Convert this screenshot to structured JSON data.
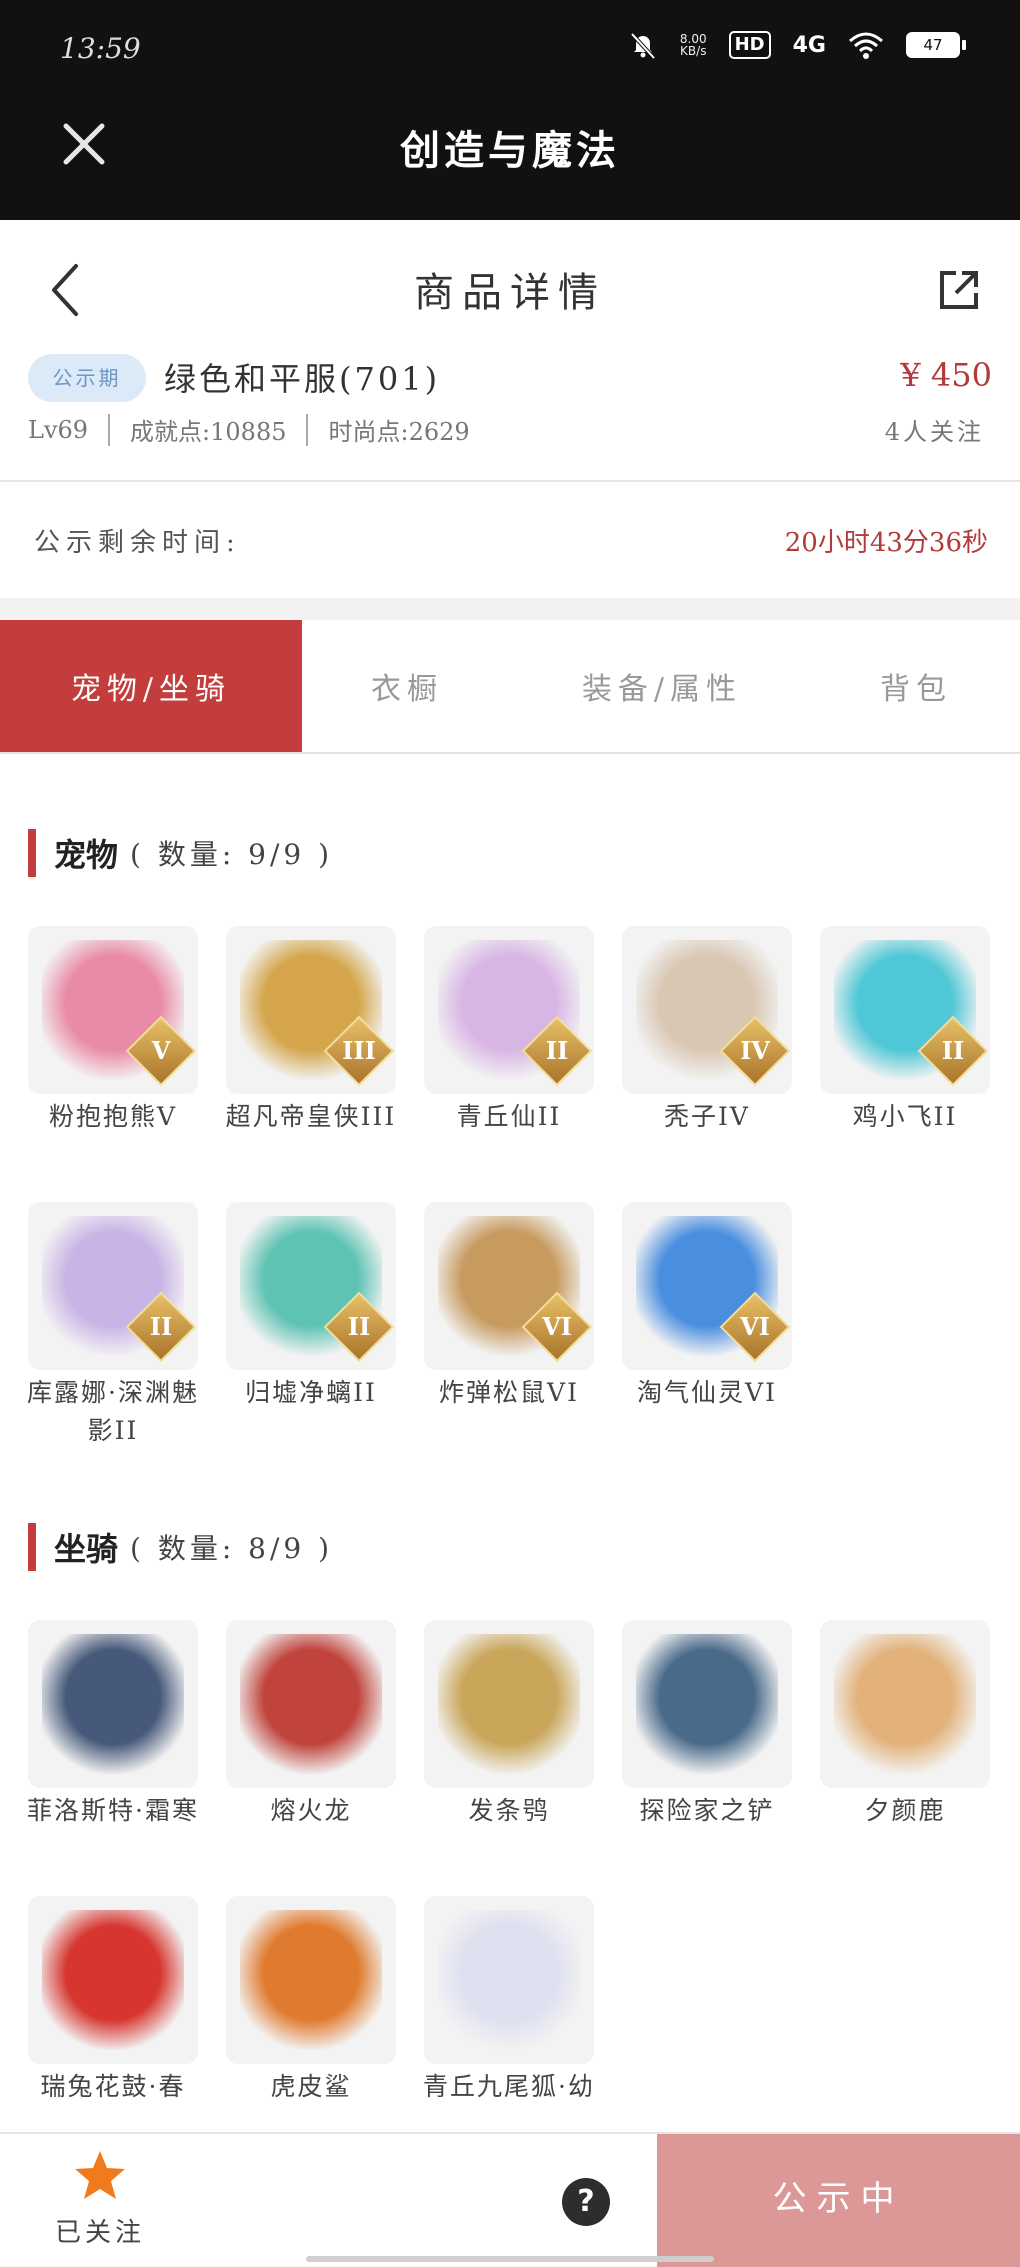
{
  "status_bar": {
    "time": "13:59",
    "speed_value": "8.00",
    "speed_unit": "KB/s",
    "hd": "HD",
    "network": "4G",
    "battery": "47"
  },
  "app": {
    "title": "创造与魔法"
  },
  "nav": {
    "title": "商品详情"
  },
  "item": {
    "badge": "公示期",
    "name": "绿色和平服(701)",
    "price": "¥ 450",
    "level": "Lv69",
    "achievement": "成就点:10885",
    "fashion": "时尚点:2629",
    "followers": "4人关注"
  },
  "countdown": {
    "label": "公示剩余时间:",
    "value": "20小时43分36秒"
  },
  "tabs": [
    "宠物/坐骑",
    "衣橱",
    "装备/属性",
    "背包"
  ],
  "pets": {
    "title": "宠物",
    "count": "( 数量: 9/9 )",
    "items": [
      {
        "name": "粉抱抱熊V",
        "rank": "V",
        "color": "#e98aa6"
      },
      {
        "name": "超凡帝皇侠III",
        "rank": "III",
        "color": "#d4a54a"
      },
      {
        "name": "青丘仙II",
        "rank": "II",
        "color": "#d8b6e4"
      },
      {
        "name": "秃子IV",
        "rank": "IV",
        "color": "#d9c7b4"
      },
      {
        "name": "鸡小飞II",
        "rank": "II",
        "color": "#4fc7d6"
      },
      {
        "name": "库露娜·深渊魅影II",
        "rank": "II",
        "color": "#c9b4e6"
      },
      {
        "name": "归墟净螭II",
        "rank": "II",
        "color": "#5fc3b3"
      },
      {
        "name": "炸弹松鼠VI",
        "rank": "VI",
        "color": "#c79a5e"
      },
      {
        "name": "淘气仙灵VI",
        "rank": "VI",
        "color": "#4a8ee0"
      }
    ]
  },
  "mounts": {
    "title": "坐骑",
    "count": "( 数量: 8/9 )",
    "items": [
      {
        "name": "菲洛斯特·霜寒",
        "color": "#47597a"
      },
      {
        "name": "熔火龙",
        "color": "#c0443c"
      },
      {
        "name": "发条鸮",
        "color": "#c9a65a"
      },
      {
        "name": "探险家之铲",
        "color": "#4a6a8a"
      },
      {
        "name": "夕颜鹿",
        "color": "#e2b27a"
      },
      {
        "name": "瑞兔花鼓·春",
        "color": "#d6362f"
      },
      {
        "name": "虎皮鲨",
        "color": "#e07a2e"
      },
      {
        "name": "青丘九尾狐·幼",
        "color": "#dfe0f0"
      }
    ]
  },
  "bottom": {
    "follow_label": "已关注",
    "help": "?",
    "action_label": "公示中"
  }
}
